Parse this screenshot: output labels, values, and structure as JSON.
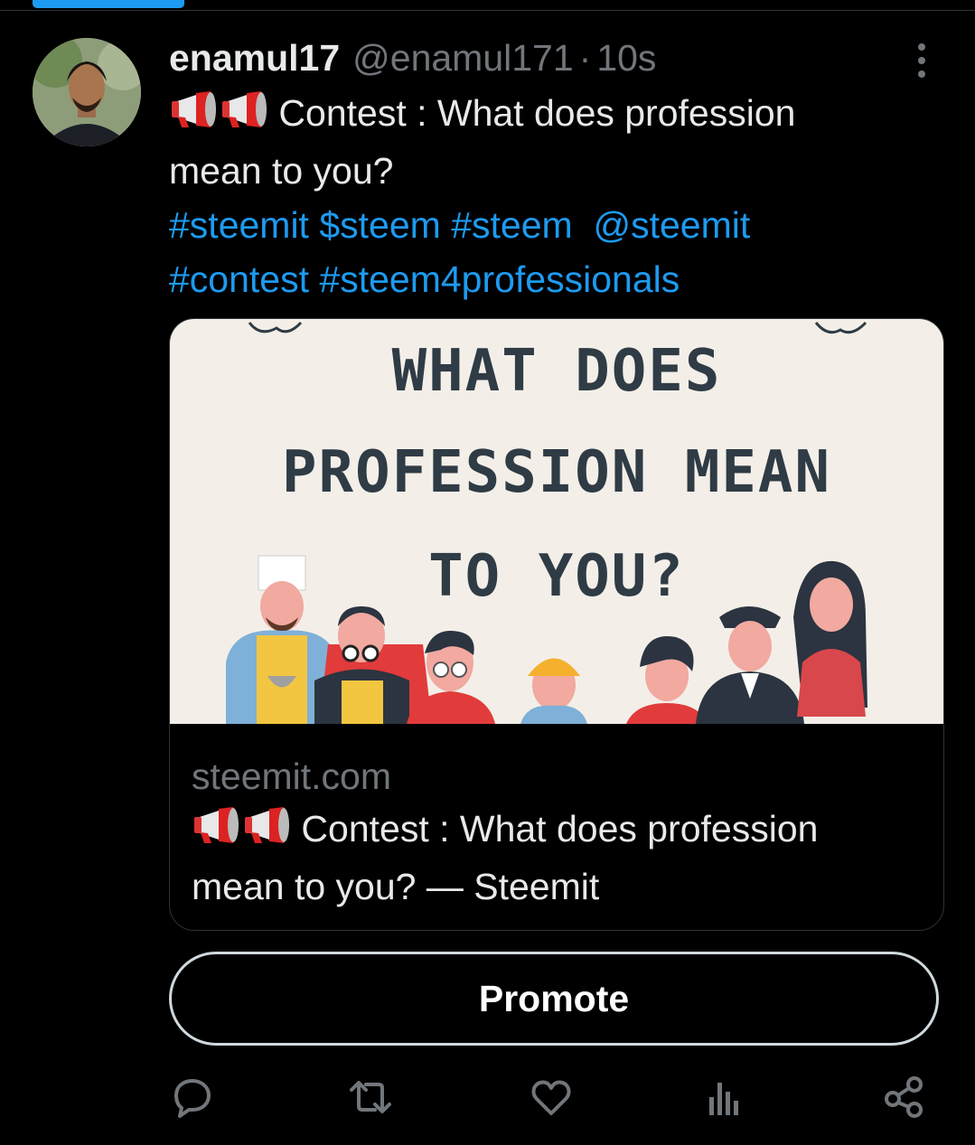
{
  "tweet": {
    "display_name": "enamul17",
    "handle": "@enamul171",
    "separator": "·",
    "time": "10s",
    "text_line1": "Contest : What does profession",
    "text_line2": "mean to you?",
    "hashtags_line1": [
      "#steemit",
      "$steem",
      "#steem",
      "@steemit"
    ],
    "hashtags_line2": [
      "#contest",
      "#steem4professionals"
    ]
  },
  "card": {
    "image_lines": [
      "WHAT DOES",
      "PROFESSION MEAN",
      "TO YOU?"
    ],
    "domain": "steemit.com",
    "title_line1": "Contest : What does profession",
    "title_line2": "mean to you? — Steemit"
  },
  "promote_label": "Promote",
  "icons": {
    "more": "more-vertical-icon",
    "reply": "reply-icon",
    "retweet": "retweet-icon",
    "like": "heart-icon",
    "views": "views-icon",
    "share": "share-icon",
    "megaphone": "megaphone-icon"
  },
  "colors": {
    "accent": "#1d9bf0",
    "background": "#000000",
    "muted": "#71767b"
  }
}
